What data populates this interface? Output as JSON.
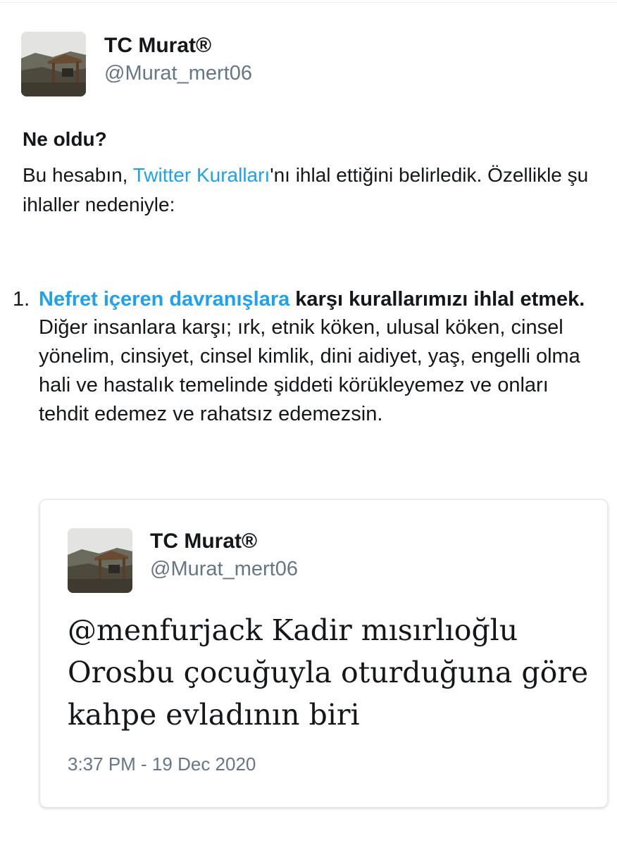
{
  "account": {
    "display_name": "TC Murat®",
    "handle": "@Murat_mert06"
  },
  "notice": {
    "title": "Ne oldu?",
    "intro_before_link": "Bu hesabın, ",
    "rules_link": "Twitter Kuralları",
    "intro_after_link": "'nı ihlal ettiğini belirledik. Özellikle şu ihlaller nedeniyle:"
  },
  "violations": [
    {
      "number": "1.",
      "link_text": "Nefret içeren davranışlara",
      "title_rest": " karşı kurallarımızı ihlal etmek.",
      "description": "Diğer insanlara karşı; ırk, etnik köken, ulusal köken, cinsel yönelim, cinsiyet, cinsel kimlik, dini aidiyet, yaş, engelli olma hali ve hastalık temelinde şiddeti körükleyemez ve onları tehdit edemez ve rahatsız edemezsin."
    }
  ],
  "tweet": {
    "display_name": "TC Murat®",
    "handle": "@Murat_mert06",
    "text": "@menfurjack Kadir mısırlıoğlu Orosbu çocuğuyla oturduğuna göre kahpe evladının biri",
    "timestamp": "3:37 PM - 19 Dec 2020"
  },
  "icons": {
    "avatar": "profile-photo-cabin-on-hillside"
  },
  "colors": {
    "link": "#1da1f2",
    "secondary_text": "#657786",
    "primary_text": "#14171a"
  }
}
